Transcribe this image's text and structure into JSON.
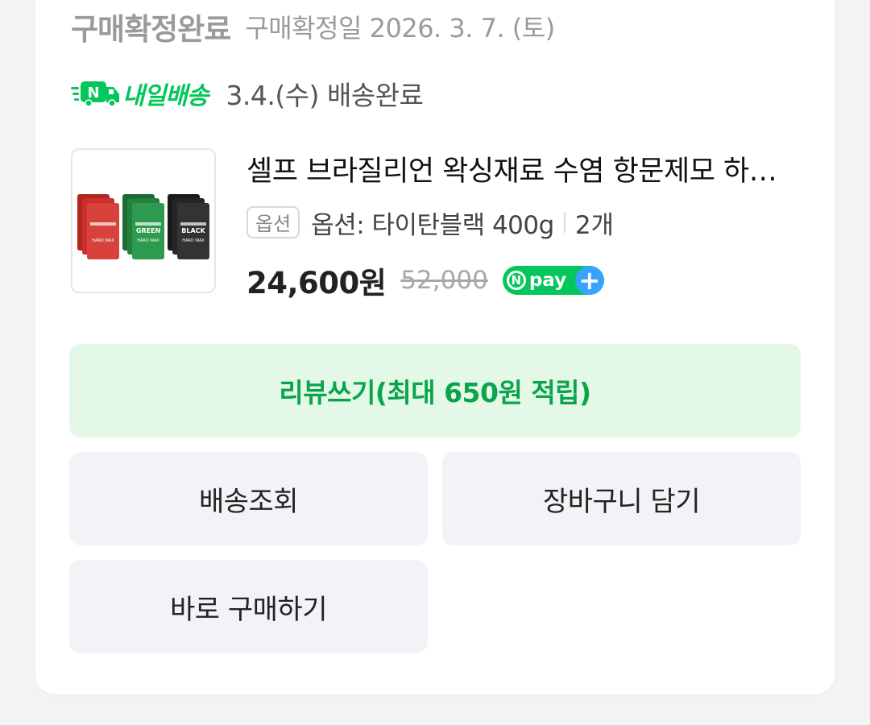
{
  "order": {
    "status_title": "구매확정완료",
    "status_date": "구매확정일 2026. 3. 7. (토)"
  },
  "delivery": {
    "icon": "delivery-truck-icon",
    "brand": "내일배송",
    "status": "3.4.(수) 배송완료"
  },
  "product": {
    "name": "셀프 브라질리언 왁싱재료 수염 항문제모 하드왁스",
    "option_badge": "옵션",
    "option_text": "옵션: 타이탄블랙 400g",
    "quantity": "2개",
    "price": "24,600원",
    "original_price": "52,000",
    "npay_text": "pay",
    "npay_n": "N",
    "npay_plus": "+",
    "thumbnail_labels": [
      "HARD WAX",
      "GREEN",
      "BLACK"
    ]
  },
  "buttons": {
    "review": "리뷰쓰기(최대 650원 적립)",
    "track": "배송조회",
    "cart": "장바구니 담기",
    "buy_now": "바로 구매하기"
  },
  "colors": {
    "brand_green": "#03c75a",
    "review_bg": "#e3f8e7",
    "button_gray": "#f2f3f6",
    "npay_plus_blue": "#36a4ff"
  }
}
